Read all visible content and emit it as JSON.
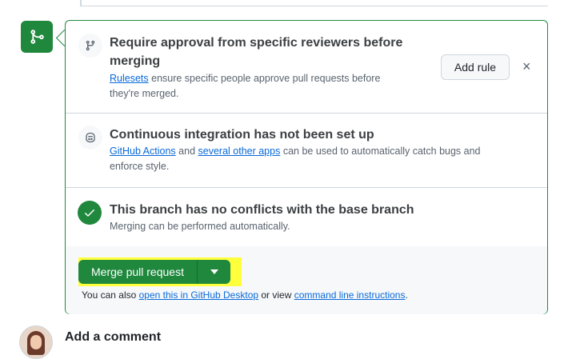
{
  "requirement": {
    "title_line1": "Require approval from specific reviewers before",
    "title_line2": "merging",
    "link": "Rulesets",
    "desc_part1": " ensure specific people approve pull requests before",
    "desc_line2": "they're merged.",
    "add_rule_label": "Add rule",
    "dismiss_glyph": "×"
  },
  "ci": {
    "title": "Continuous integration has not been set up",
    "link1": "GitHub Actions",
    "between": " and ",
    "link2": "several other apps",
    "desc_part2": " can be used to automatically catch bugs and",
    "desc_line2": "enforce style."
  },
  "conflicts": {
    "title": "This branch has no conflicts with the base branch",
    "desc": "Merging can be performed automatically."
  },
  "merge": {
    "button_label": "Merge pull request",
    "also_text": "You can also ",
    "desktop_link": "open this in GitHub Desktop",
    "or_view": " or view ",
    "cli_link": "command line instructions",
    "period": "."
  },
  "comment": {
    "heading": "Add a comment"
  },
  "colors": {
    "success": "#1f883d",
    "link": "#0969da",
    "highlight": "#ffff3c",
    "border": "#d0d7de"
  },
  "icons": [
    "git-merge-icon",
    "git-branch-icon",
    "copilot-icon",
    "check-icon",
    "triangle-down-icon"
  ]
}
